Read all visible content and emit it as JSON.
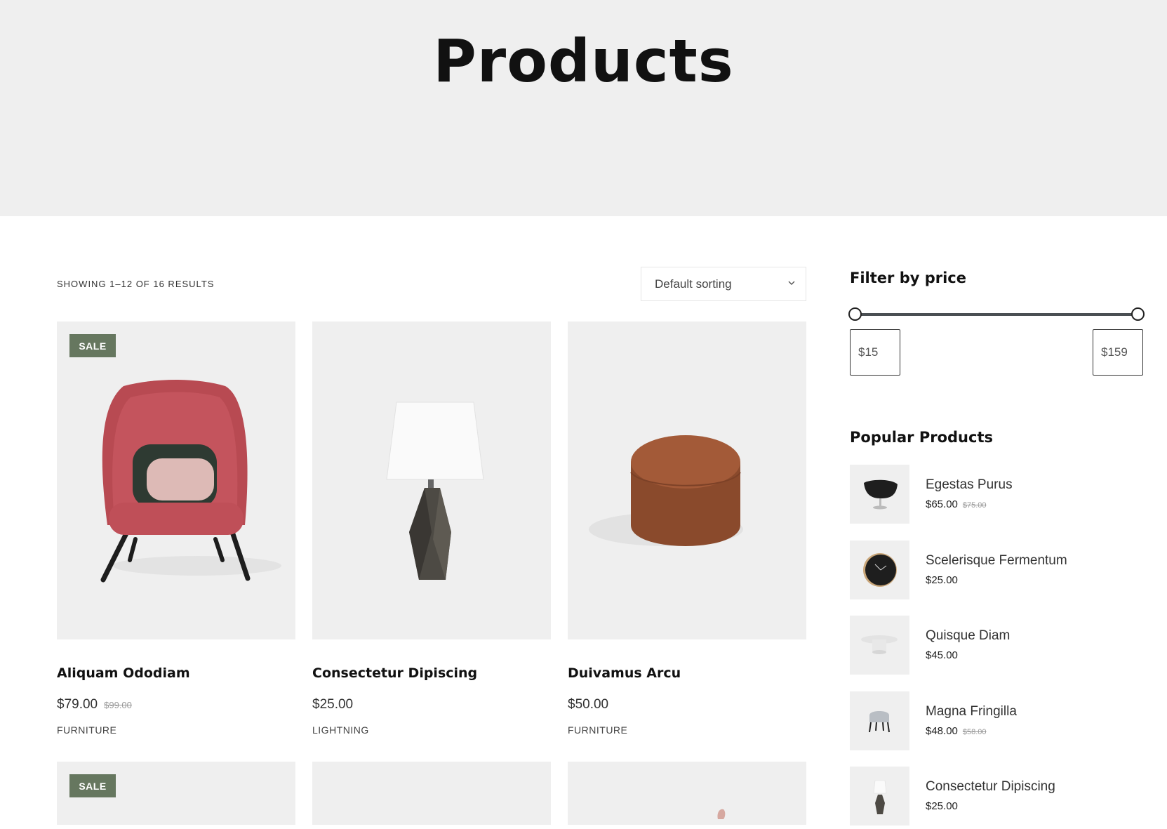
{
  "page": {
    "title": "Products"
  },
  "toolbar": {
    "result_count": "SHOWING 1–12 OF 16 RESULTS",
    "sort_selected": "Default sorting"
  },
  "products": [
    {
      "title": "Aliquam Ododiam",
      "price": "$79.00",
      "old_price": "$99.00",
      "category": "FURNITURE",
      "badge": "SALE",
      "image": "red-armchair"
    },
    {
      "title": "Consectetur Dipiscing",
      "price": "$25.00",
      "old_price": "",
      "category": "LIGHTNING",
      "badge": "",
      "image": "table-lamp"
    },
    {
      "title": "Duivamus Arcu",
      "price": "$50.00",
      "old_price": "",
      "category": "FURNITURE",
      "badge": "",
      "image": "brown-pouf"
    }
  ],
  "next_row": {
    "badge": "SALE"
  },
  "sidebar": {
    "filter_heading": "Filter by price",
    "min_price": "$15",
    "max_price": "$159",
    "popular_heading": "Popular Products",
    "popular": [
      {
        "name": "Egestas Purus",
        "price": "$65.00",
        "old_price": "$75.00",
        "image": "black-swivel-chair"
      },
      {
        "name": "Scelerisque Fermentum",
        "price": "$25.00",
        "old_price": "",
        "image": "wall-clock"
      },
      {
        "name": "Quisque Diam",
        "price": "$45.00",
        "old_price": "",
        "image": "round-side-table"
      },
      {
        "name": "Magna Fringilla",
        "price": "$48.00",
        "old_price": "$58.00",
        "image": "grey-stool"
      },
      {
        "name": "Consectetur Dipiscing",
        "price": "$25.00",
        "old_price": "",
        "image": "table-lamp"
      }
    ]
  },
  "colors": {
    "hero_bg": "#efefef",
    "sale_badge": "#66775f",
    "slider_track": "#4a4f53"
  }
}
